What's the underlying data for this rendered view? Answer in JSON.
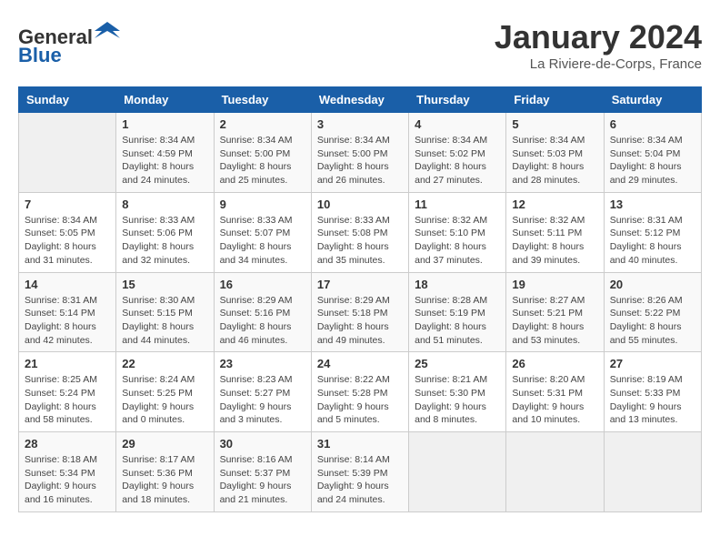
{
  "header": {
    "logo_general": "General",
    "logo_blue": "Blue",
    "month_title": "January 2024",
    "location": "La Riviere-de-Corps, France"
  },
  "weekdays": [
    "Sunday",
    "Monday",
    "Tuesday",
    "Wednesday",
    "Thursday",
    "Friday",
    "Saturday"
  ],
  "weeks": [
    [
      {
        "day": "",
        "content": ""
      },
      {
        "day": "1",
        "content": "Sunrise: 8:34 AM\nSunset: 4:59 PM\nDaylight: 8 hours\nand 24 minutes."
      },
      {
        "day": "2",
        "content": "Sunrise: 8:34 AM\nSunset: 5:00 PM\nDaylight: 8 hours\nand 25 minutes."
      },
      {
        "day": "3",
        "content": "Sunrise: 8:34 AM\nSunset: 5:00 PM\nDaylight: 8 hours\nand 26 minutes."
      },
      {
        "day": "4",
        "content": "Sunrise: 8:34 AM\nSunset: 5:02 PM\nDaylight: 8 hours\nand 27 minutes."
      },
      {
        "day": "5",
        "content": "Sunrise: 8:34 AM\nSunset: 5:03 PM\nDaylight: 8 hours\nand 28 minutes."
      },
      {
        "day": "6",
        "content": "Sunrise: 8:34 AM\nSunset: 5:04 PM\nDaylight: 8 hours\nand 29 minutes."
      }
    ],
    [
      {
        "day": "7",
        "content": "Sunrise: 8:34 AM\nSunset: 5:05 PM\nDaylight: 8 hours\nand 31 minutes."
      },
      {
        "day": "8",
        "content": "Sunrise: 8:33 AM\nSunset: 5:06 PM\nDaylight: 8 hours\nand 32 minutes."
      },
      {
        "day": "9",
        "content": "Sunrise: 8:33 AM\nSunset: 5:07 PM\nDaylight: 8 hours\nand 34 minutes."
      },
      {
        "day": "10",
        "content": "Sunrise: 8:33 AM\nSunset: 5:08 PM\nDaylight: 8 hours\nand 35 minutes."
      },
      {
        "day": "11",
        "content": "Sunrise: 8:32 AM\nSunset: 5:10 PM\nDaylight: 8 hours\nand 37 minutes."
      },
      {
        "day": "12",
        "content": "Sunrise: 8:32 AM\nSunset: 5:11 PM\nDaylight: 8 hours\nand 39 minutes."
      },
      {
        "day": "13",
        "content": "Sunrise: 8:31 AM\nSunset: 5:12 PM\nDaylight: 8 hours\nand 40 minutes."
      }
    ],
    [
      {
        "day": "14",
        "content": "Sunrise: 8:31 AM\nSunset: 5:14 PM\nDaylight: 8 hours\nand 42 minutes."
      },
      {
        "day": "15",
        "content": "Sunrise: 8:30 AM\nSunset: 5:15 PM\nDaylight: 8 hours\nand 44 minutes."
      },
      {
        "day": "16",
        "content": "Sunrise: 8:29 AM\nSunset: 5:16 PM\nDaylight: 8 hours\nand 46 minutes."
      },
      {
        "day": "17",
        "content": "Sunrise: 8:29 AM\nSunset: 5:18 PM\nDaylight: 8 hours\nand 49 minutes."
      },
      {
        "day": "18",
        "content": "Sunrise: 8:28 AM\nSunset: 5:19 PM\nDaylight: 8 hours\nand 51 minutes."
      },
      {
        "day": "19",
        "content": "Sunrise: 8:27 AM\nSunset: 5:21 PM\nDaylight: 8 hours\nand 53 minutes."
      },
      {
        "day": "20",
        "content": "Sunrise: 8:26 AM\nSunset: 5:22 PM\nDaylight: 8 hours\nand 55 minutes."
      }
    ],
    [
      {
        "day": "21",
        "content": "Sunrise: 8:25 AM\nSunset: 5:24 PM\nDaylight: 8 hours\nand 58 minutes."
      },
      {
        "day": "22",
        "content": "Sunrise: 8:24 AM\nSunset: 5:25 PM\nDaylight: 9 hours\nand 0 minutes."
      },
      {
        "day": "23",
        "content": "Sunrise: 8:23 AM\nSunset: 5:27 PM\nDaylight: 9 hours\nand 3 minutes."
      },
      {
        "day": "24",
        "content": "Sunrise: 8:22 AM\nSunset: 5:28 PM\nDaylight: 9 hours\nand 5 minutes."
      },
      {
        "day": "25",
        "content": "Sunrise: 8:21 AM\nSunset: 5:30 PM\nDaylight: 9 hours\nand 8 minutes."
      },
      {
        "day": "26",
        "content": "Sunrise: 8:20 AM\nSunset: 5:31 PM\nDaylight: 9 hours\nand 10 minutes."
      },
      {
        "day": "27",
        "content": "Sunrise: 8:19 AM\nSunset: 5:33 PM\nDaylight: 9 hours\nand 13 minutes."
      }
    ],
    [
      {
        "day": "28",
        "content": "Sunrise: 8:18 AM\nSunset: 5:34 PM\nDaylight: 9 hours\nand 16 minutes."
      },
      {
        "day": "29",
        "content": "Sunrise: 8:17 AM\nSunset: 5:36 PM\nDaylight: 9 hours\nand 18 minutes."
      },
      {
        "day": "30",
        "content": "Sunrise: 8:16 AM\nSunset: 5:37 PM\nDaylight: 9 hours\nand 21 minutes."
      },
      {
        "day": "31",
        "content": "Sunrise: 8:14 AM\nSunset: 5:39 PM\nDaylight: 9 hours\nand 24 minutes."
      },
      {
        "day": "",
        "content": ""
      },
      {
        "day": "",
        "content": ""
      },
      {
        "day": "",
        "content": ""
      }
    ]
  ]
}
